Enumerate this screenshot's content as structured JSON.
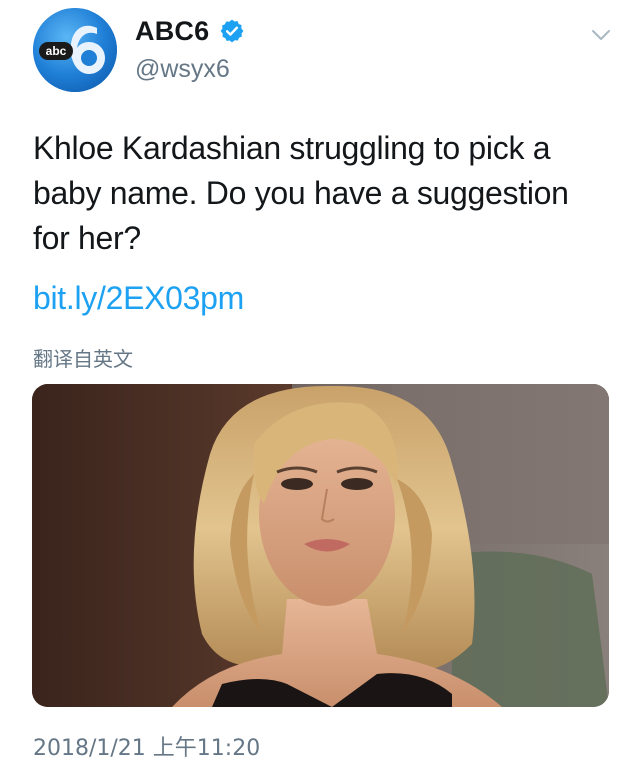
{
  "author": {
    "display_name": "ABC6",
    "handle": "@wsyx6",
    "verified": true,
    "verified_icon": "verified-badge-icon",
    "avatar_logo_text": "abc",
    "avatar_icon": "abc6-logo-icon"
  },
  "menu": {
    "icon": "chevron-down-icon"
  },
  "tweet": {
    "text": "Khloe Kardashian struggling to pick a baby name. Do you have a suggestion for her?",
    "link": "bit.ly/2EX03pm",
    "translate_label": "翻译自英文",
    "timestamp": "2018/1/21 上午11:20"
  },
  "media": {
    "icon": "photo-icon"
  },
  "colors": {
    "link": "#1da1f2",
    "secondary_text": "#657786",
    "verified": "#1da1f2",
    "avatar_blue": "#1f7fd6"
  }
}
